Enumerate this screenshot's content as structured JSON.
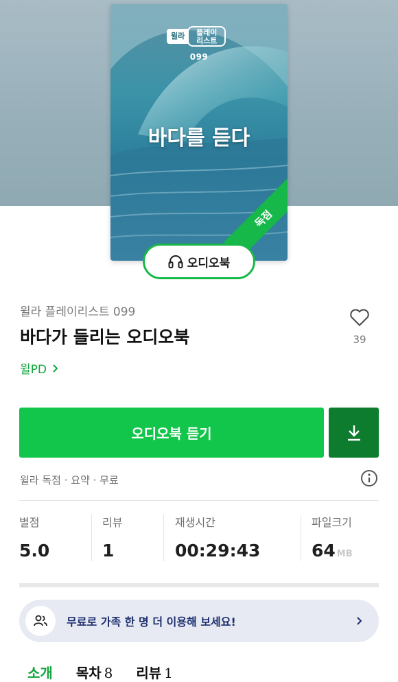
{
  "cover": {
    "logo_brand": "윌라",
    "logo_tag": "플레이 리스트",
    "issue_number": "099",
    "title": "바다를 듣다",
    "ribbon": "독점"
  },
  "badge": {
    "label": "오디오북",
    "icon": "headphones-icon"
  },
  "book": {
    "series": "윌라 플레이리스트 099",
    "title": "바다가 들리는 오디오북",
    "author": "윌PD",
    "likes": "39"
  },
  "actions": {
    "listen_label": "오디오북 듣기",
    "download_icon": "download-icon"
  },
  "meta_line": "윌라 독점 · 요약 · 무료",
  "stats": {
    "rating_label": "별점",
    "rating_value": "5.0",
    "review_label": "리뷰",
    "review_value": "1",
    "duration_label": "재생시간",
    "duration_value": "00:29:43",
    "size_label": "파일크기",
    "size_value": "64",
    "size_unit": "MB"
  },
  "family_banner": {
    "text": "무료로 가족 한 명 더 이용해 보세요!"
  },
  "tabs": [
    {
      "label": "소개",
      "count": ""
    },
    {
      "label": "목차",
      "count": "8"
    },
    {
      "label": "리뷰",
      "count": "1"
    }
  ],
  "colors": {
    "accent_green": "#11c64a",
    "dark_green": "#0e7c2f",
    "banner_bg": "#e7eaf2",
    "banner_text": "#1e2f6e"
  }
}
